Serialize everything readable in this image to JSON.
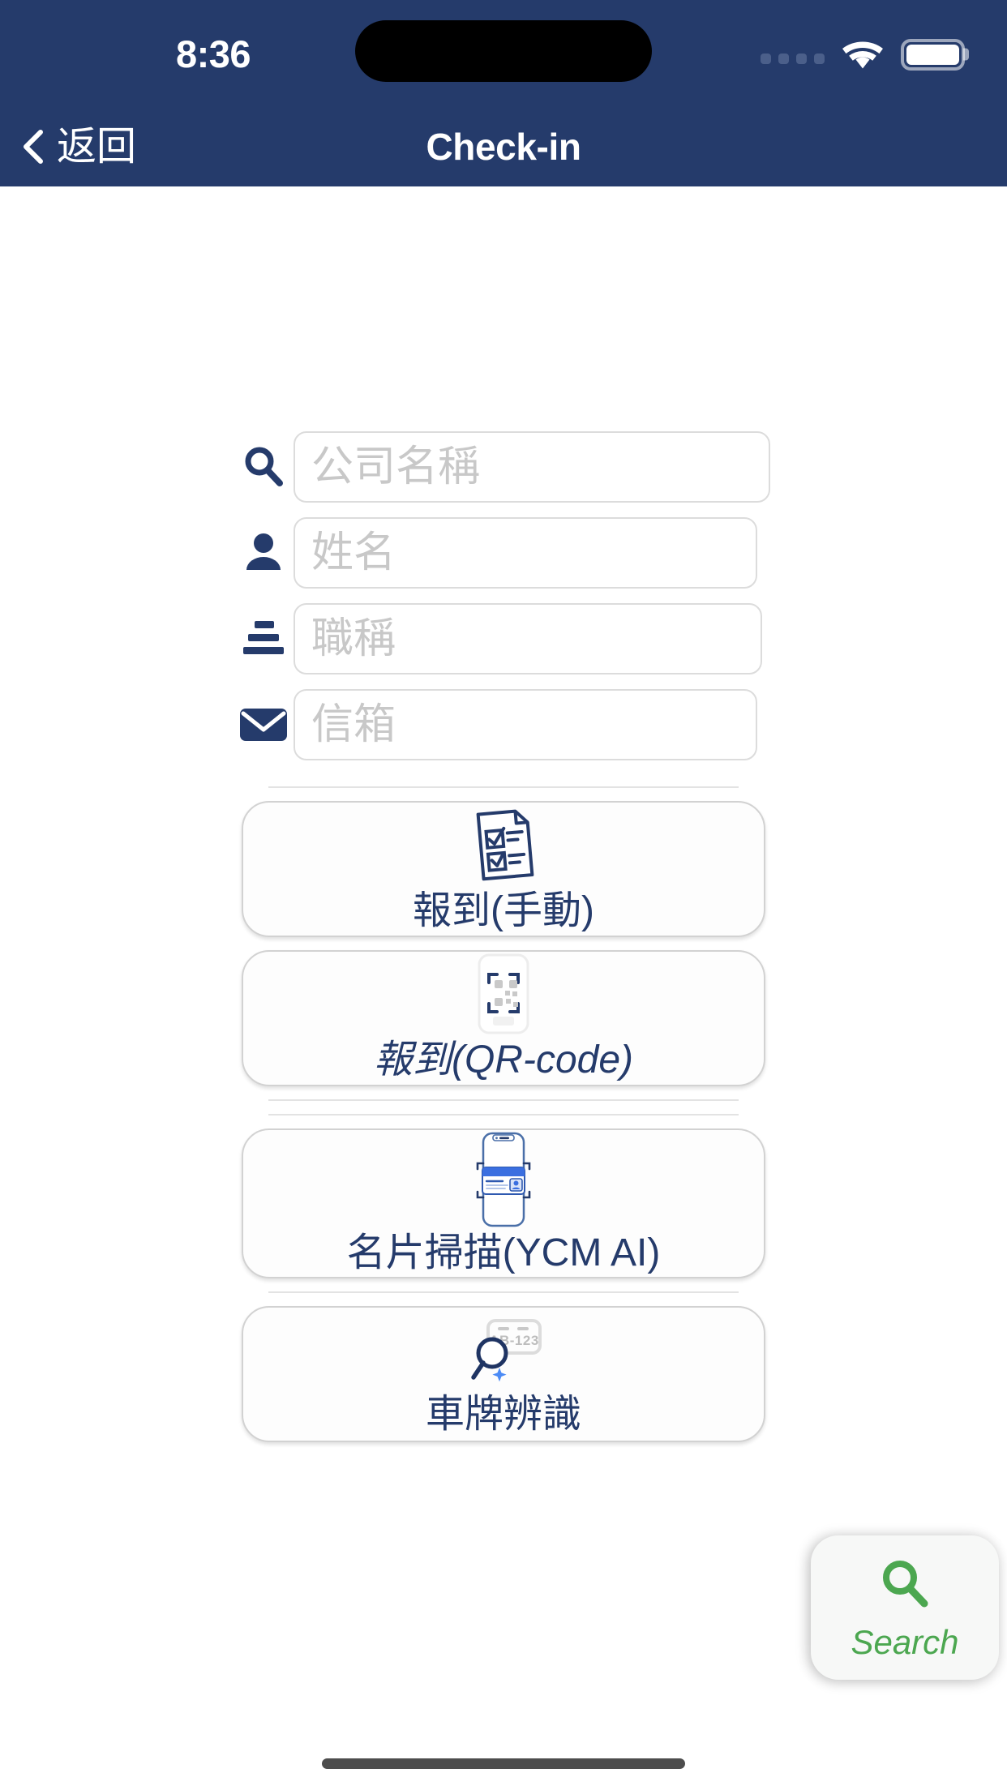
{
  "status_bar": {
    "time": "8:36",
    "cellular_icon": "cellular-dots-icon",
    "wifi_icon": "wifi-icon",
    "battery_icon": "battery-full-icon"
  },
  "nav_bar": {
    "back_icon": "chevron-left-icon",
    "back_label": "返回",
    "title": "Check-in"
  },
  "form": {
    "fields": [
      {
        "icon": "search-icon",
        "placeholder": "公司名稱",
        "value": ""
      },
      {
        "icon": "person-icon",
        "placeholder": "姓名",
        "value": ""
      },
      {
        "icon": "job-title-icon",
        "placeholder": "職稱",
        "value": ""
      },
      {
        "icon": "envelope-icon",
        "placeholder": "信箱",
        "value": ""
      }
    ]
  },
  "actions": [
    {
      "icon": "checklist-document-icon",
      "label": "報到(手動)"
    },
    {
      "icon": "qr-code-scan-icon",
      "label": "報到(QR-code)"
    },
    {
      "icon": "business-card-scan-icon",
      "label": "名片掃描(YCM AI)"
    },
    {
      "icon": "license-plate-search-icon",
      "label": "車牌辨識"
    }
  ],
  "fab": {
    "icon": "search-icon",
    "label": "Search"
  },
  "colors": {
    "header_navy": "#253B6B",
    "text_navy": "#253B6B",
    "placeholder_gray": "#C8C8C8",
    "border_gray": "#D2D2D2",
    "accent_green": "#4CA750",
    "card_blue": "#3B6FE0",
    "page_background": "#FFFFFF"
  }
}
